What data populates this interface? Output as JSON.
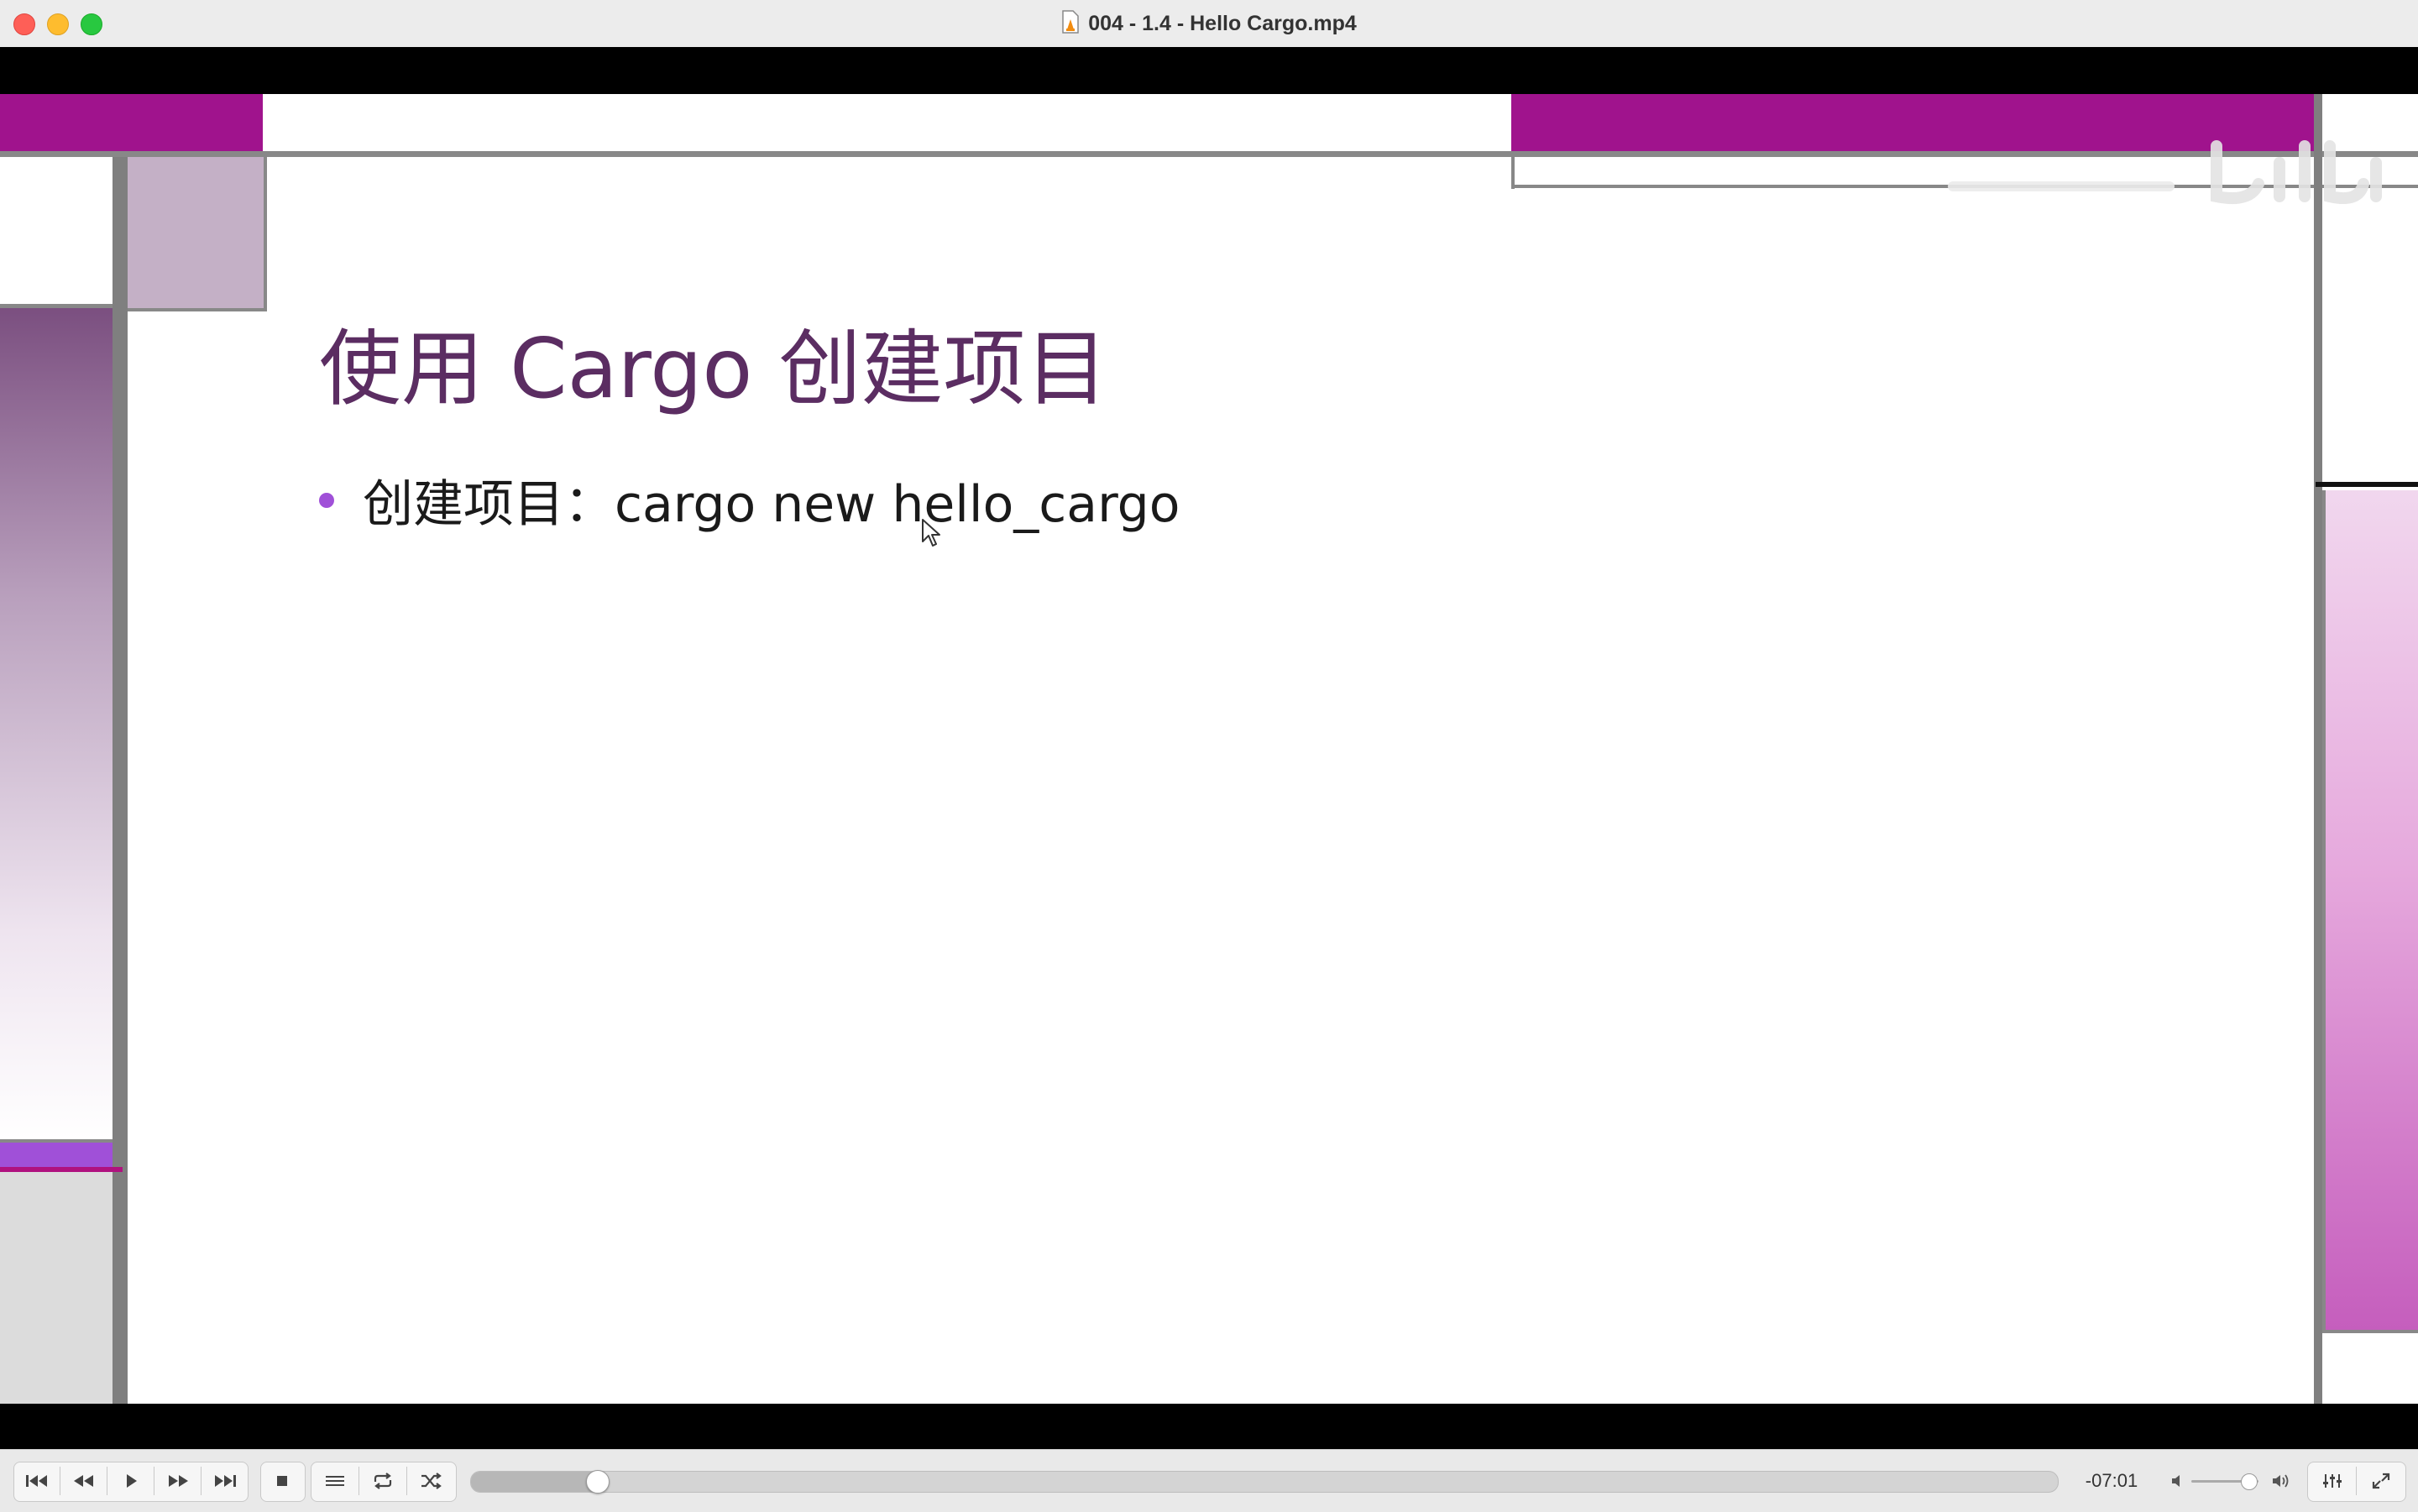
{
  "window": {
    "title": "004 - 1.4 - Hello Cargo.mp4",
    "traffic_lights": {
      "close": "#fe5f57",
      "minimize": "#febc2e",
      "zoom": "#28c840"
    }
  },
  "slide": {
    "title": "使用 Cargo 创建项目",
    "bullets": [
      "创建项目：cargo new hello_cargo"
    ],
    "colors": {
      "accent": "#a0138d",
      "title": "#5b2d62",
      "bullet": "#a050d8"
    }
  },
  "controls": {
    "time_remaining": "-07:01",
    "progress": 0.08,
    "volume": 0.85,
    "icons": [
      "skip-back-icon",
      "rewind-icon",
      "play-icon",
      "fast-forward-icon",
      "skip-forward-icon",
      "stop-icon",
      "playlist-icon",
      "repeat-icon",
      "shuffle-icon",
      "volume-mute-icon",
      "volume-max-icon",
      "equalizer-icon",
      "fullscreen-icon"
    ]
  }
}
